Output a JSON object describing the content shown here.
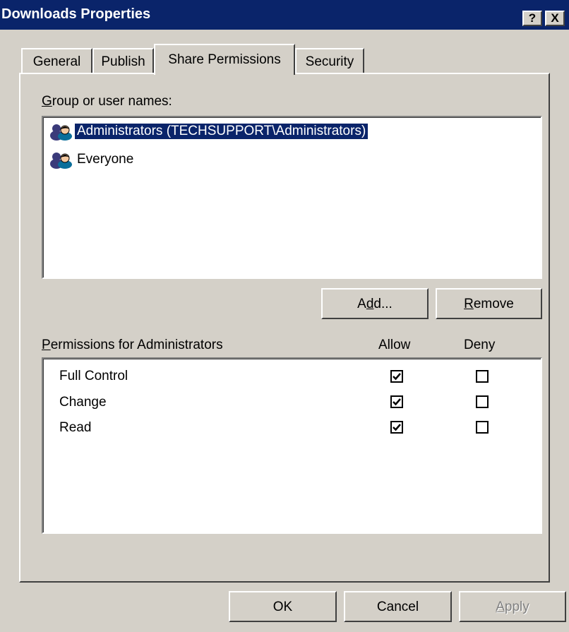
{
  "window": {
    "title": "Downloads Properties",
    "help_label": "?",
    "close_label": "X"
  },
  "tabs": [
    {
      "label": "General",
      "active": false
    },
    {
      "label": "Publish",
      "active": false
    },
    {
      "label": "Share Permissions",
      "active": true
    },
    {
      "label": "Security",
      "active": false
    }
  ],
  "groups": {
    "label_mnemonic": "G",
    "label_rest": "roup or user names:",
    "items": [
      {
        "label": "Administrators (TECHSUPPORT\\Administrators)",
        "icon": "user-group-icon",
        "selected": true
      },
      {
        "label": "Everyone",
        "icon": "user-group-icon",
        "selected": false
      }
    ]
  },
  "buttons": {
    "add_pre": "A",
    "add_mnemonic": "d",
    "add_post": "d...",
    "remove_mnemonic": "R",
    "remove_rest": "emove",
    "ok": "OK",
    "cancel": "Cancel",
    "apply_mnemonic": "A",
    "apply_rest": "pply"
  },
  "permissions": {
    "label_mnemonic": "P",
    "label_rest": "ermissions for Administrators",
    "allow_header": "Allow",
    "deny_header": "Deny",
    "rows": [
      {
        "name": "Full Control",
        "allow": true,
        "deny": false
      },
      {
        "name": "Change",
        "allow": true,
        "deny": false
      },
      {
        "name": "Read",
        "allow": true,
        "deny": false
      }
    ]
  }
}
